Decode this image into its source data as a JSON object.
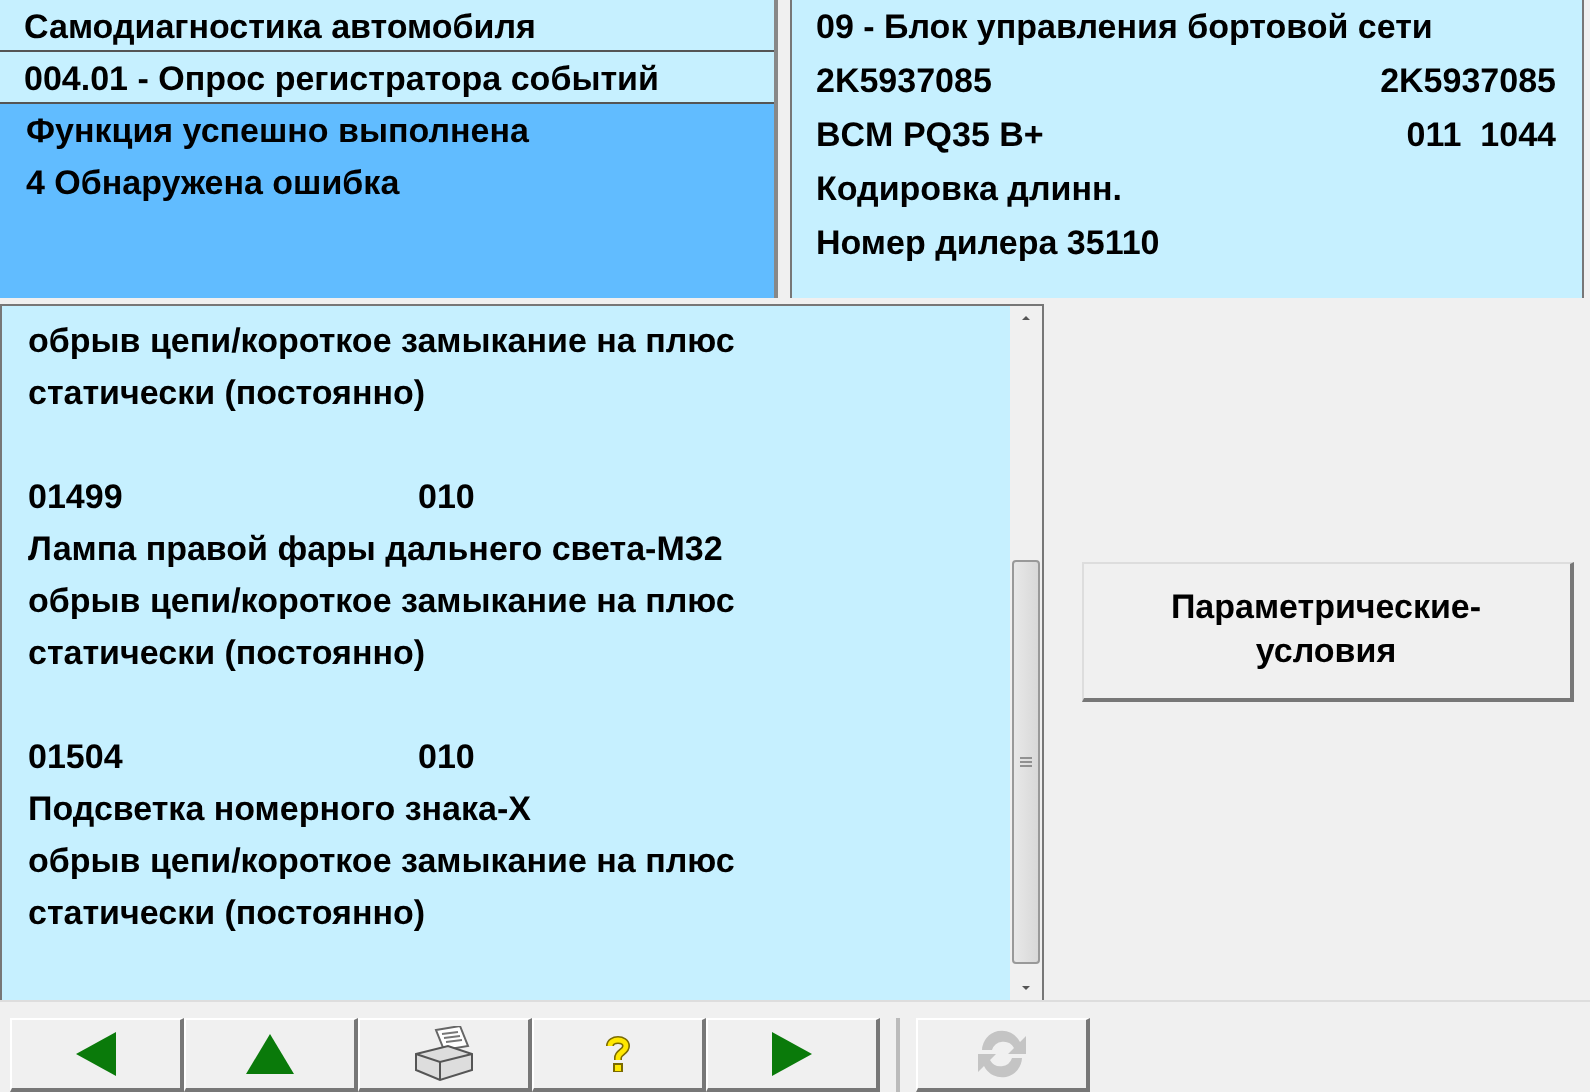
{
  "header_left": {
    "title": "Самодиагностика автомобиля",
    "function": "004.01 - Опрос регистратора событий",
    "status_lines": [
      "Функция успешно выполнена",
      "4 Обнаружена ошибка"
    ]
  },
  "header_right": {
    "rows": [
      {
        "left": "09 - Блок управления бортовой сети"
      },
      {
        "left": "2K5937085",
        "right": "2K5937085"
      },
      {
        "left": "BCM PQ35 B+",
        "right": "011  1044"
      },
      {
        "left": "Кодировка длинн."
      },
      {
        "left": "Номер дилера 35110"
      }
    ]
  },
  "fault_list": {
    "entries": [
      {
        "lines": [
          "обрыв цепи/короткое замыкание на плюс",
          "статически (постоянно)"
        ]
      },
      {
        "code": "01499",
        "column_2": "010",
        "name": "Лампа правой фары дальнего света-M32",
        "lines": [
          "обрыв цепи/короткое замыкание на плюс",
          "статически (постоянно)"
        ]
      },
      {
        "code": "01504",
        "column_2": "010",
        "name": "Подсветка номерного знака-X",
        "lines": [
          "обрыв цепи/короткое замыкание на плюс",
          "статически (постоянно)"
        ]
      }
    ]
  },
  "side_button": {
    "label": "Параметрические-\nусловия"
  },
  "toolbar": [
    {
      "kind": "back",
      "disabled": false
    },
    {
      "kind": "up",
      "disabled": false
    },
    {
      "kind": "print",
      "disabled": false
    },
    {
      "kind": "help",
      "disabled": false
    },
    {
      "kind": "next",
      "disabled": false
    },
    {
      "kind": "refresh",
      "disabled": true
    }
  ]
}
